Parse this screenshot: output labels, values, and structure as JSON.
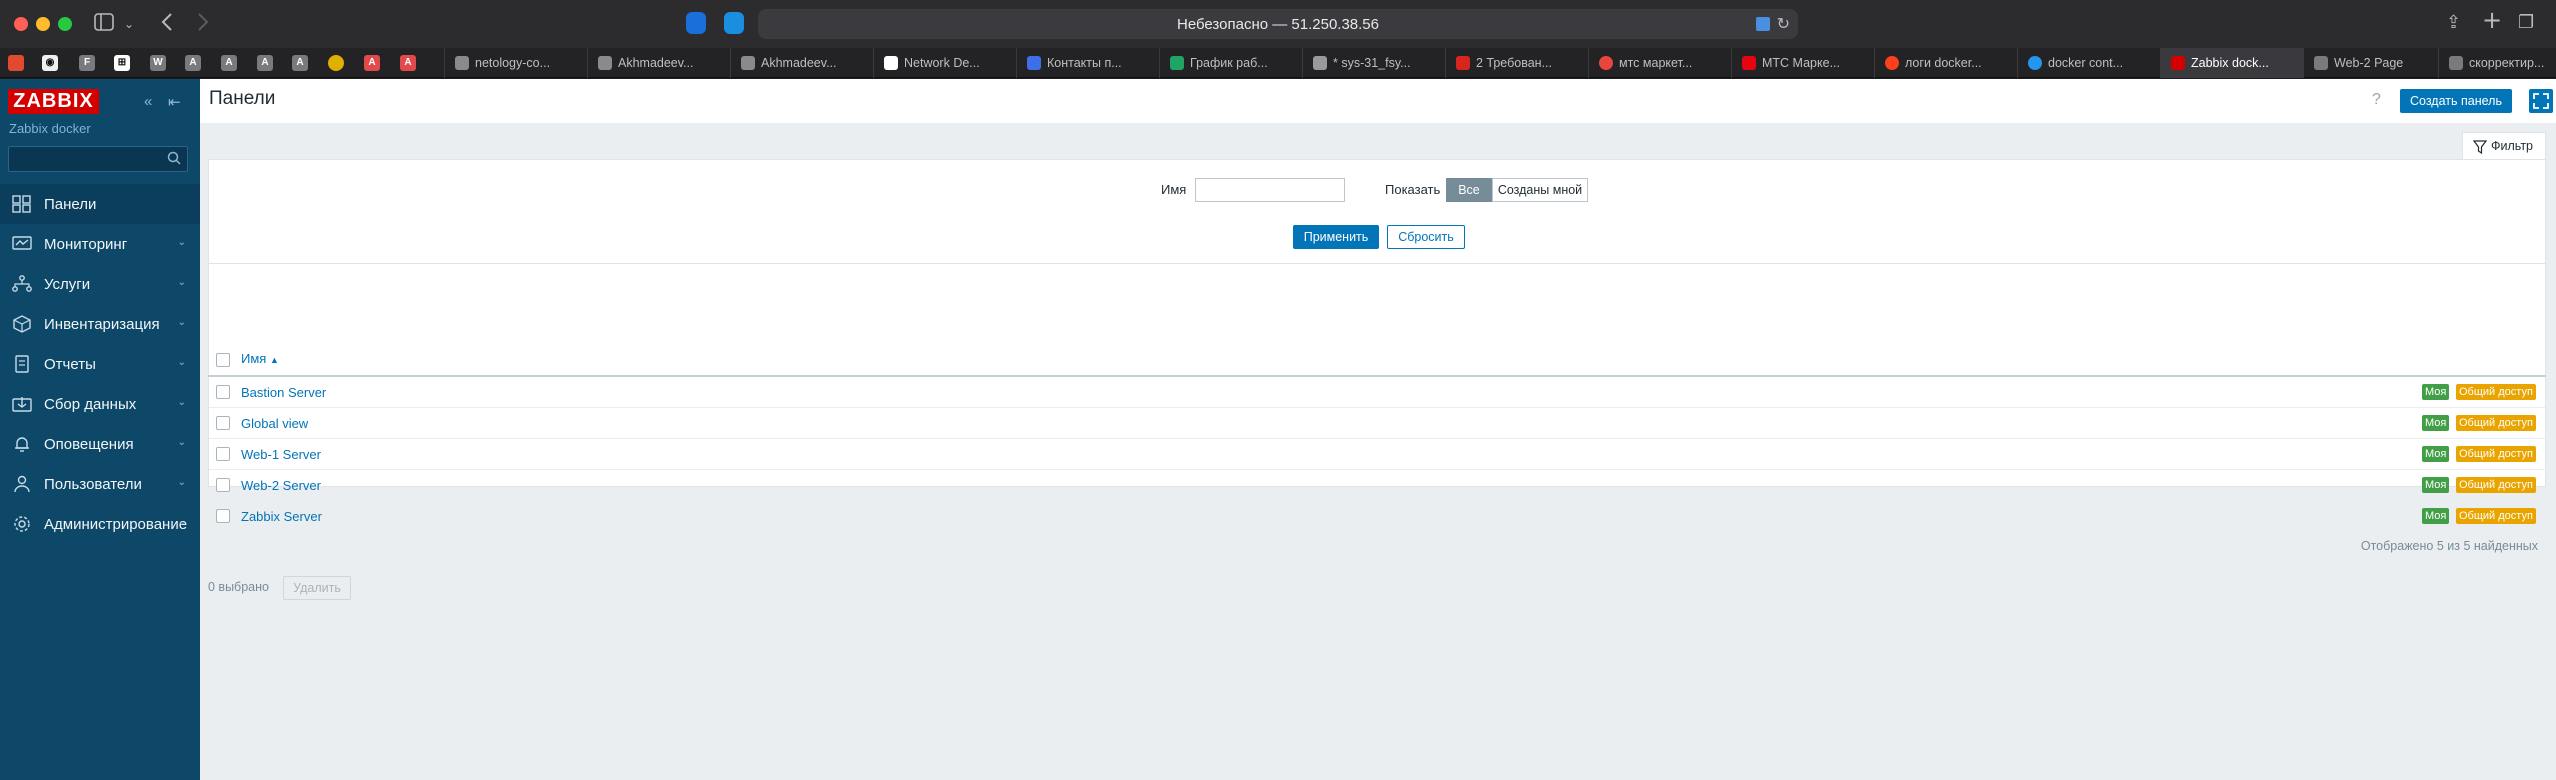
{
  "browser": {
    "url_text": "Небезопасно — 51.250.38.56",
    "pinned_tabs": [
      "github",
      "F",
      "notion",
      "W",
      "A",
      "A",
      "A",
      "A",
      "sun",
      "A",
      "A"
    ],
    "tabs": [
      {
        "label": "netology-co..."
      },
      {
        "label": "Akhmadeev..."
      },
      {
        "label": "Akhmadeev..."
      },
      {
        "label": "Network De..."
      },
      {
        "label": "Контакты п..."
      },
      {
        "label": "График раб..."
      },
      {
        "label": "* sys-31_fsy..."
      },
      {
        "label": "2 Требован..."
      },
      {
        "label": "мтс маркет..."
      },
      {
        "label": "МТС Марке..."
      },
      {
        "label": "логи docker..."
      },
      {
        "label": "docker cont..."
      },
      {
        "label": "Zabbix dock..."
      },
      {
        "label": "Web-2 Page"
      },
      {
        "label": "скорректир..."
      }
    ]
  },
  "sidebar": {
    "logo": "ZABBIX",
    "server_name": "Zabbix docker",
    "search_placeholder": "",
    "items": [
      {
        "label": "Панели",
        "icon": "dashboard-icon"
      },
      {
        "label": "Мониторинг",
        "icon": "monitoring-icon"
      },
      {
        "label": "Услуги",
        "icon": "services-icon"
      },
      {
        "label": "Инвентаризация",
        "icon": "inventory-icon"
      },
      {
        "label": "Отчеты",
        "icon": "reports-icon"
      },
      {
        "label": "Сбор данных",
        "icon": "data-collection-icon"
      },
      {
        "label": "Оповещения",
        "icon": "bell-icon"
      },
      {
        "label": "Пользователи",
        "icon": "users-icon"
      },
      {
        "label": "Администрирование",
        "icon": "gear-icon"
      }
    ]
  },
  "header": {
    "title": "Панели",
    "help": "?",
    "create_button": "Создать панель"
  },
  "filter": {
    "tab_label": "Фильтр",
    "name_label": "Имя",
    "name_value": "",
    "show_label": "Показать",
    "show_options": [
      "Все",
      "Созданы мной"
    ],
    "apply_button": "Применить",
    "reset_button": "Сбросить"
  },
  "table": {
    "column_name": "Имя",
    "sort_indicator": "▲",
    "rows": [
      {
        "name": "Bastion Server",
        "badge_mine": "Моя",
        "badge_shared": "Общий доступ"
      },
      {
        "name": "Global view",
        "badge_mine": "Моя",
        "badge_shared": "Общий доступ"
      },
      {
        "name": "Web-1 Server",
        "badge_mine": "Моя",
        "badge_shared": "Общий доступ"
      },
      {
        "name": "Web-2 Server",
        "badge_mine": "Моя",
        "badge_shared": "Общий доступ"
      },
      {
        "name": "Zabbix Server",
        "badge_mine": "Моя",
        "badge_shared": "Общий доступ"
      }
    ],
    "found_text": "Отображено 5 из 5 найденных"
  },
  "footer": {
    "selected_text": "0 выбрано",
    "delete_button": "Удалить"
  },
  "colors": {
    "sidebar_bg": "#0e4868",
    "primary": "#0275b8",
    "badge_mine": "#429e47",
    "badge_shared": "#e9a400",
    "logo_red": "#d40000"
  }
}
